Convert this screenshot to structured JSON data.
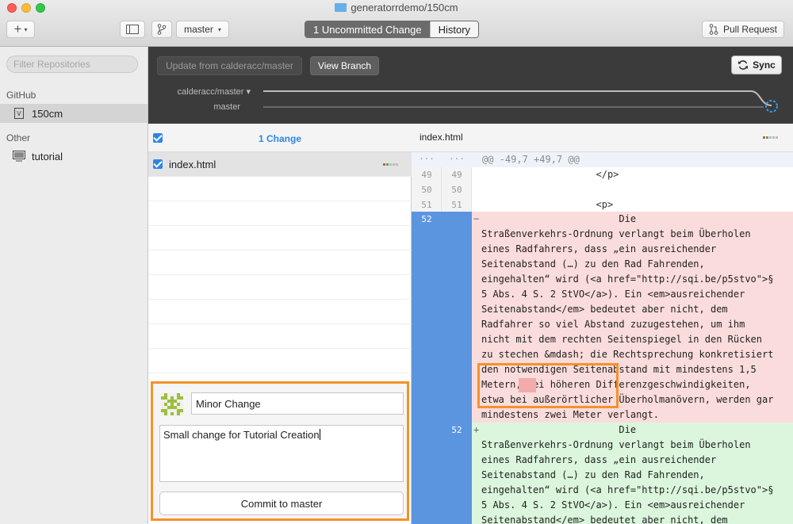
{
  "window": {
    "title": "generatorrdemo/150cm"
  },
  "toolbar": {
    "add_label": "+",
    "branch": "master",
    "tabs": [
      {
        "label": "1 Uncommitted Change"
      },
      {
        "label": "History"
      }
    ],
    "pull_request_label": "Pull Request"
  },
  "sidebar": {
    "filter_placeholder": "Filter Repositories",
    "groups": [
      {
        "label": "GitHub",
        "repos": [
          {
            "name": "150cm"
          }
        ]
      },
      {
        "label": "Other",
        "repos": [
          {
            "name": "tutorial"
          }
        ]
      }
    ]
  },
  "sync_bar": {
    "update_label": "Update from calderacc/master",
    "view_branch_label": "View Branch",
    "sync_label": "Sync",
    "branches": [
      "calderacc/master ▾",
      "master"
    ]
  },
  "changes": {
    "header": "1 Change",
    "files": [
      {
        "name": "index.html"
      }
    ]
  },
  "commit": {
    "summary": "Minor Change",
    "description": "Small change for Tutorial Creation",
    "button_label": "Commit to master"
  },
  "diff": {
    "file": "index.html",
    "hunk_header": "@@ -49,7 +49,7 @@",
    "context_lines": [
      {
        "old": "49",
        "new": "49",
        "text": "                    </p>"
      },
      {
        "old": "50",
        "new": "50",
        "text": ""
      },
      {
        "old": "51",
        "new": "51",
        "text": "                    <p>"
      }
    ],
    "removed": {
      "line": "52",
      "marker": "−",
      "lines": [
        "                        Die",
        "Straßenverkehrs-Ordnung verlangt beim Überholen",
        "eines Radfahrers, dass „ein ausreichender",
        "Seitenabstand (…) zu den Rad Fahrenden,",
        "eingehalten“ wird (<a href=\"http://sqi.be/p5stvo\">§",
        "5 Abs. 4 S. 2 StVO</a>). Ein <em>ausreichender",
        "Seitenabstand</em> bedeutet aber nicht, dem",
        "Radfahrer so viel Abstand zuzugestehen, um ihm",
        "nicht mit dem rechten Seitenspiegel in den Rücken",
        "zu stechen &mdash; die Rechtsprechung konkretisiert",
        "den notwendigen Seitenabstand mit mindestens 1,5",
        "Metern, bei höheren Differenzgeschwindigkeiten,",
        "etwa bei außerörtlicher Überholmanövern, werden gar",
        "mindestens zwei Meter verlangt."
      ]
    },
    "added": {
      "line": "52",
      "marker": "+",
      "lines": [
        "                        Die",
        "Straßenverkehrs-Ordnung verlangt beim Überholen",
        "eines Radfahrers, dass „ein ausreichender",
        "Seitenabstand (…) zu den Rad Fahrenden,",
        "eingehalten“ wird (<a href=\"http://sqi.be/p5stvo\">§",
        "5 Abs. 4 S. 2 StVO</a>). Ein <em>ausreichender",
        "Seitenabstand</em> bedeutet aber nicht, dem"
      ]
    }
  },
  "colors": {
    "accent": "#2e86e4",
    "removed_bg": "#fbdcdc",
    "added_bg": "#dbf6dc",
    "gutter_blue": "#5b95e0",
    "highlight": "#f3922b"
  }
}
